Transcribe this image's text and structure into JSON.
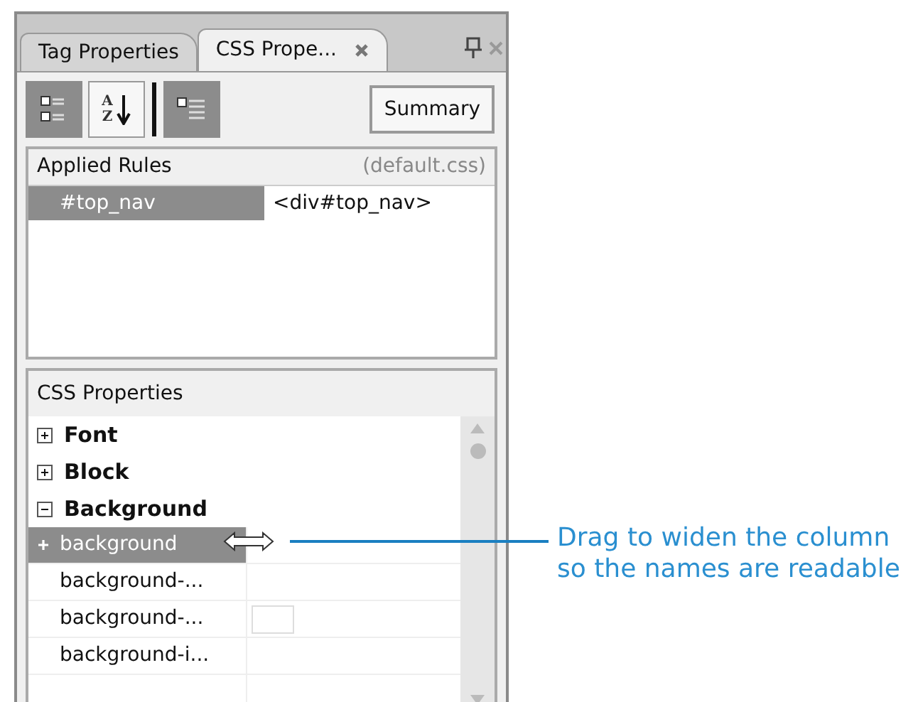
{
  "panel": {
    "tabs": [
      {
        "label": "Tag Properties",
        "selected": false
      },
      {
        "label": "CSS Prope...",
        "selected": true
      }
    ]
  },
  "toolbar": {
    "buttons": [
      {
        "kind": "categorized",
        "selected": true
      },
      {
        "kind": "alphabetical",
        "selected": false,
        "letters": [
          "A",
          "Z"
        ]
      },
      {
        "kind": "set-properties",
        "selected": true
      }
    ],
    "summary": {
      "label": "Summary",
      "selected": false
    }
  },
  "applied_rules": {
    "title": "Applied Rules",
    "source": "(default.css)",
    "rows": [
      {
        "rule": "#top_nav",
        "context": "<div#top_nav>",
        "selected": true
      }
    ]
  },
  "css_properties": {
    "title": "CSS Properties",
    "groups": [
      {
        "label": "Font",
        "expanded": false
      },
      {
        "label": "Block",
        "expanded": false
      },
      {
        "label": "Background",
        "expanded": true,
        "children": [
          {
            "name": "background",
            "expandable": true,
            "selected": true,
            "kind": "text"
          },
          {
            "name": "background-...",
            "selected": false,
            "kind": "text"
          },
          {
            "name": "background-...",
            "selected": false,
            "kind": "color"
          },
          {
            "name": "background-i...",
            "selected": false,
            "kind": "text"
          },
          {
            "selected": false,
            "kind": "text"
          }
        ]
      }
    ]
  },
  "callout": {
    "lines": [
      "Drag to widen the column",
      "so the names are readable"
    ]
  }
}
